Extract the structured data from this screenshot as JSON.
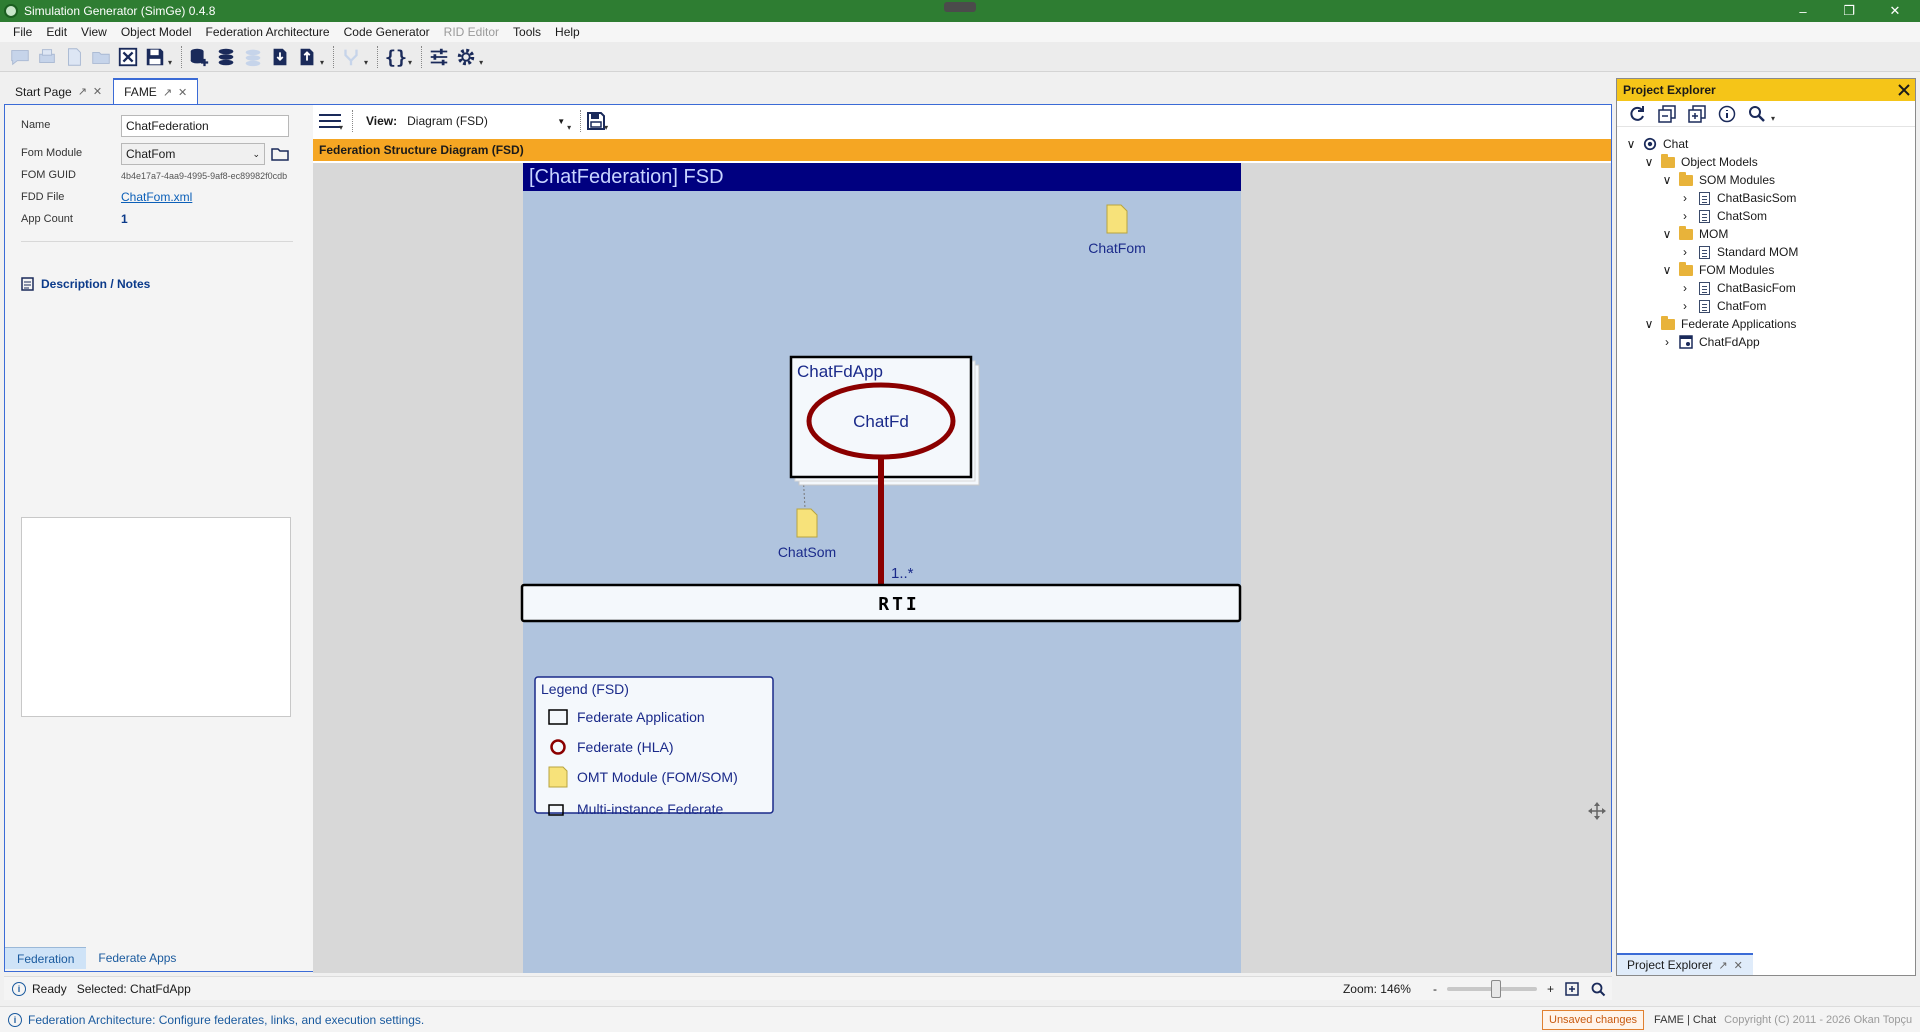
{
  "window": {
    "title": "Simulation Generator (SimGe) 0.4.8"
  },
  "menu": [
    "File",
    "Edit",
    "View",
    "Object Model",
    "Federation Architecture",
    "Code Generator",
    "RID Editor",
    "Tools",
    "Help"
  ],
  "menu_disabled": [
    "RID Editor"
  ],
  "tabs": [
    {
      "label": "Start Page"
    },
    {
      "label": "FAME"
    }
  ],
  "properties": {
    "name_label": "Name",
    "name_value": "ChatFederation",
    "fom_module_label": "Fom Module",
    "fom_module_value": "ChatFom",
    "fom_guid_label": "FOM GUID",
    "fom_guid_value": "4b4e17a7-4aa9-4995-9af8-ec89982f0cdb",
    "fdd_label": "FDD File",
    "fdd_value": "ChatFom.xml",
    "app_count_label": "App Count",
    "app_count_value": "1",
    "description_label": "Description / Notes"
  },
  "left_bottom_tabs": [
    "Federation",
    "Federate Apps"
  ],
  "diagram": {
    "view_label": "View:",
    "view_value": "Diagram (FSD)",
    "header": "Federation Structure Diagram (FSD)",
    "title": "[ChatFederation] FSD",
    "fom_module": "ChatFom",
    "som_module": "ChatSom",
    "app_name": "ChatFdApp",
    "federate_name": "ChatFd",
    "multiplicity": "1..*",
    "rti": "RTI",
    "legend": {
      "title": "Legend (FSD)",
      "items": [
        "Federate Application",
        "Federate (HLA)",
        "OMT Module (FOM/SOM)",
        "Multi-instance Federate"
      ]
    },
    "colors": {
      "canvas_bg": "#b0c4de",
      "title_bar": "#000080",
      "federate": "#8b0000",
      "header": "#f5a623"
    }
  },
  "project_explorer": {
    "title": "Project Explorer",
    "tab_label": "Project Explorer",
    "tree": [
      {
        "label": "Chat",
        "level": 0,
        "expanded": true,
        "icon": "project-icon"
      },
      {
        "label": "Object Models",
        "level": 1,
        "expanded": true,
        "icon": "folder-icon"
      },
      {
        "label": "SOM Modules",
        "level": 2,
        "expanded": true,
        "icon": "folder-icon"
      },
      {
        "label": "ChatBasicSom",
        "level": 3,
        "expanded": false,
        "icon": "document-icon"
      },
      {
        "label": "ChatSom",
        "level": 3,
        "expanded": false,
        "icon": "document-icon"
      },
      {
        "label": "MOM",
        "level": 2,
        "expanded": true,
        "icon": "folder-icon"
      },
      {
        "label": "Standard MOM",
        "level": 3,
        "expanded": false,
        "icon": "document-icon"
      },
      {
        "label": "FOM Modules",
        "level": 2,
        "expanded": true,
        "icon": "folder-icon"
      },
      {
        "label": "ChatBasicFom",
        "level": 3,
        "expanded": false,
        "icon": "document-icon"
      },
      {
        "label": "ChatFom",
        "level": 3,
        "expanded": false,
        "icon": "document-icon"
      },
      {
        "label": "Federate Applications",
        "level": 1,
        "expanded": true,
        "icon": "folder-icon"
      },
      {
        "label": "ChatFdApp",
        "level": 2,
        "expanded": false,
        "icon": "app-icon"
      }
    ]
  },
  "status": {
    "ready": "Ready",
    "selected": "Selected: ChatFdApp",
    "zoom": "Zoom: 146%",
    "zoom_minus": "-",
    "zoom_plus": "+",
    "zoom_level": 0.55,
    "bottom_message": "Federation Architecture: Configure federates, links, and execution settings.",
    "unsaved": "Unsaved changes",
    "context": "FAME | Chat",
    "copyright": "Copyright (C) 2011 - 2026 Okan Topçu"
  }
}
